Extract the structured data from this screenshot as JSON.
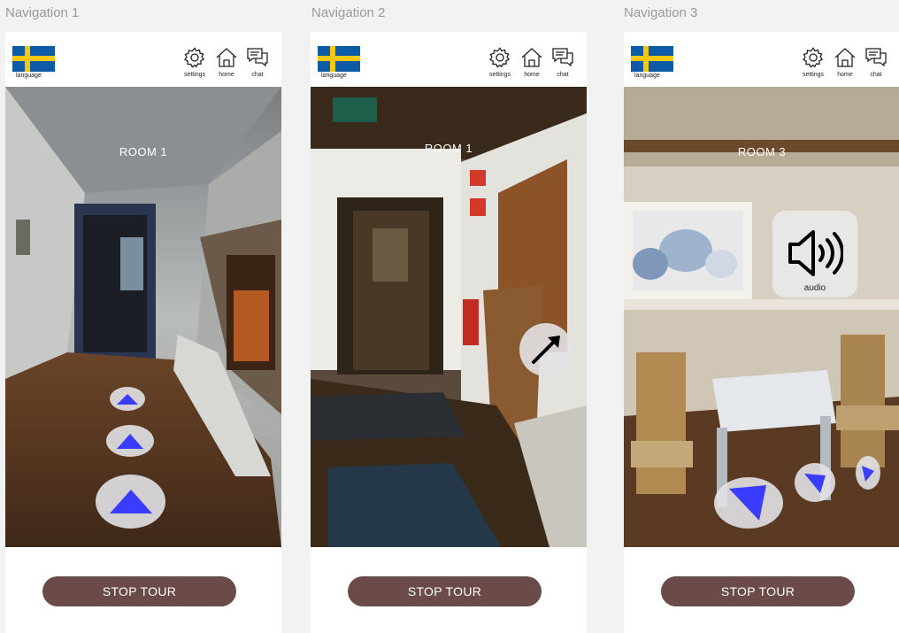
{
  "frames": [
    {
      "label": "Navigation 1",
      "flag_label": "language",
      "tools": [
        "settings",
        "home",
        "chat"
      ],
      "room_title": "ROOM 1",
      "stop_label": "STOP TOUR"
    },
    {
      "label": "Navigation 2",
      "flag_label": "language",
      "tools": [
        "settings",
        "home",
        "chat"
      ],
      "room_title": "ROOM 1",
      "stop_label": "STOP TOUR"
    },
    {
      "label": "Navigation 3",
      "flag_label": "language",
      "tools": [
        "settings",
        "home",
        "chat"
      ],
      "room_title": "ROOM 3",
      "stop_label": "STOP TOUR",
      "audio_label": "audio"
    }
  ],
  "icons": {
    "flag": "swedish-flag-icon",
    "settings": "gear-icon",
    "home": "house-icon",
    "chat": "chat-bubbles-icon",
    "nav_arrow": "triangle-arrow-icon",
    "diagonal_arrow": "diagonal-arrow-icon",
    "audio": "speaker-icon"
  },
  "colors": {
    "flag_blue": "#0d5aa7",
    "flag_yellow": "#f7c90a",
    "nav_arrow": "#3a3dff",
    "stop_button": "#6b4a4a"
  }
}
